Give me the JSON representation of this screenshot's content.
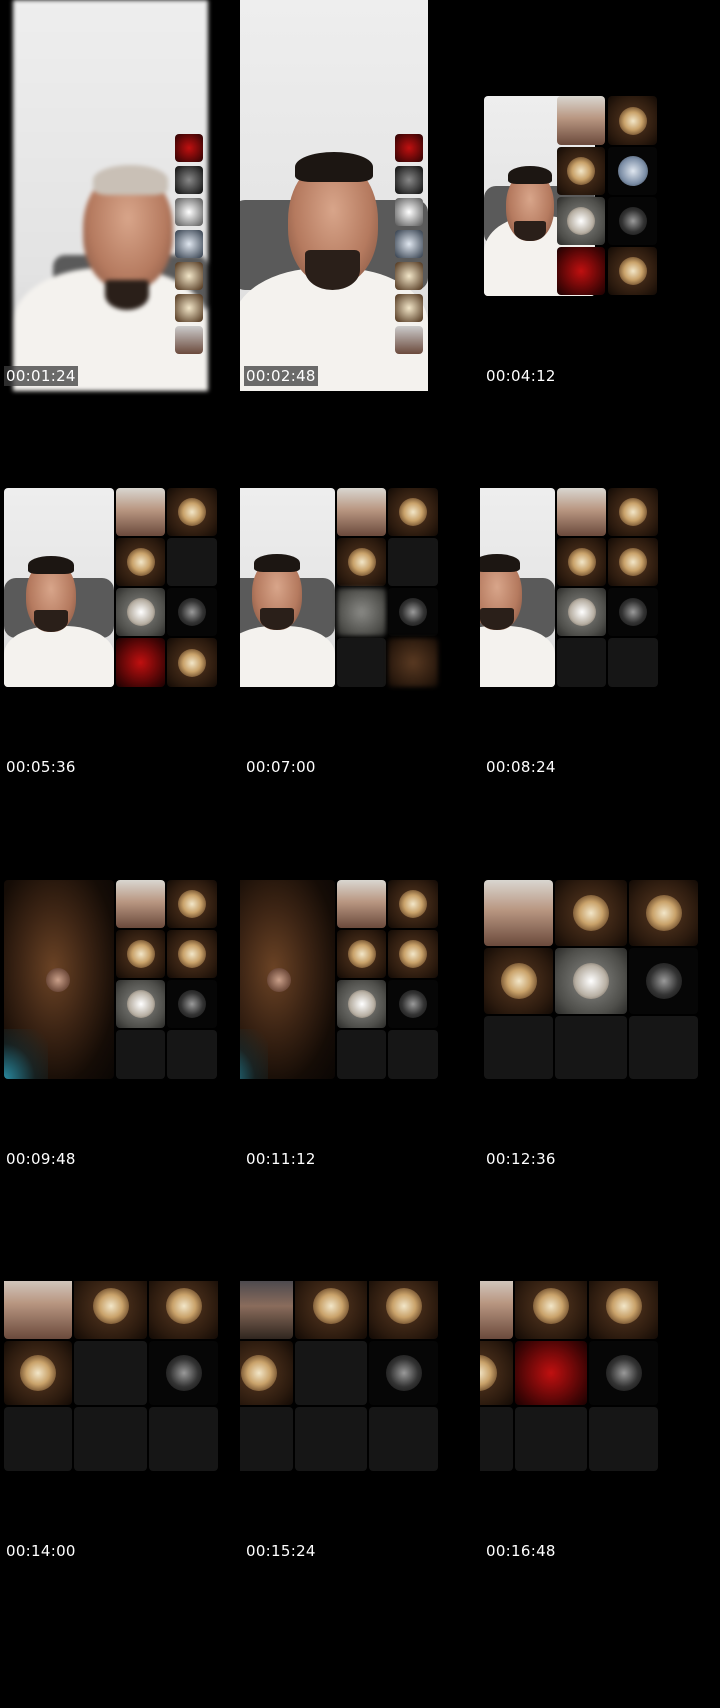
{
  "timestamps": [
    "00:01:24",
    "00:02:48",
    "00:04:12",
    "00:05:36",
    "00:07:00",
    "00:08:24",
    "00:09:48",
    "00:11:12",
    "00:12:36",
    "00:14:00",
    "00:15:24",
    "00:16:48"
  ],
  "colors": {
    "background": "#000000",
    "timestamp_text": "#ffffff"
  }
}
